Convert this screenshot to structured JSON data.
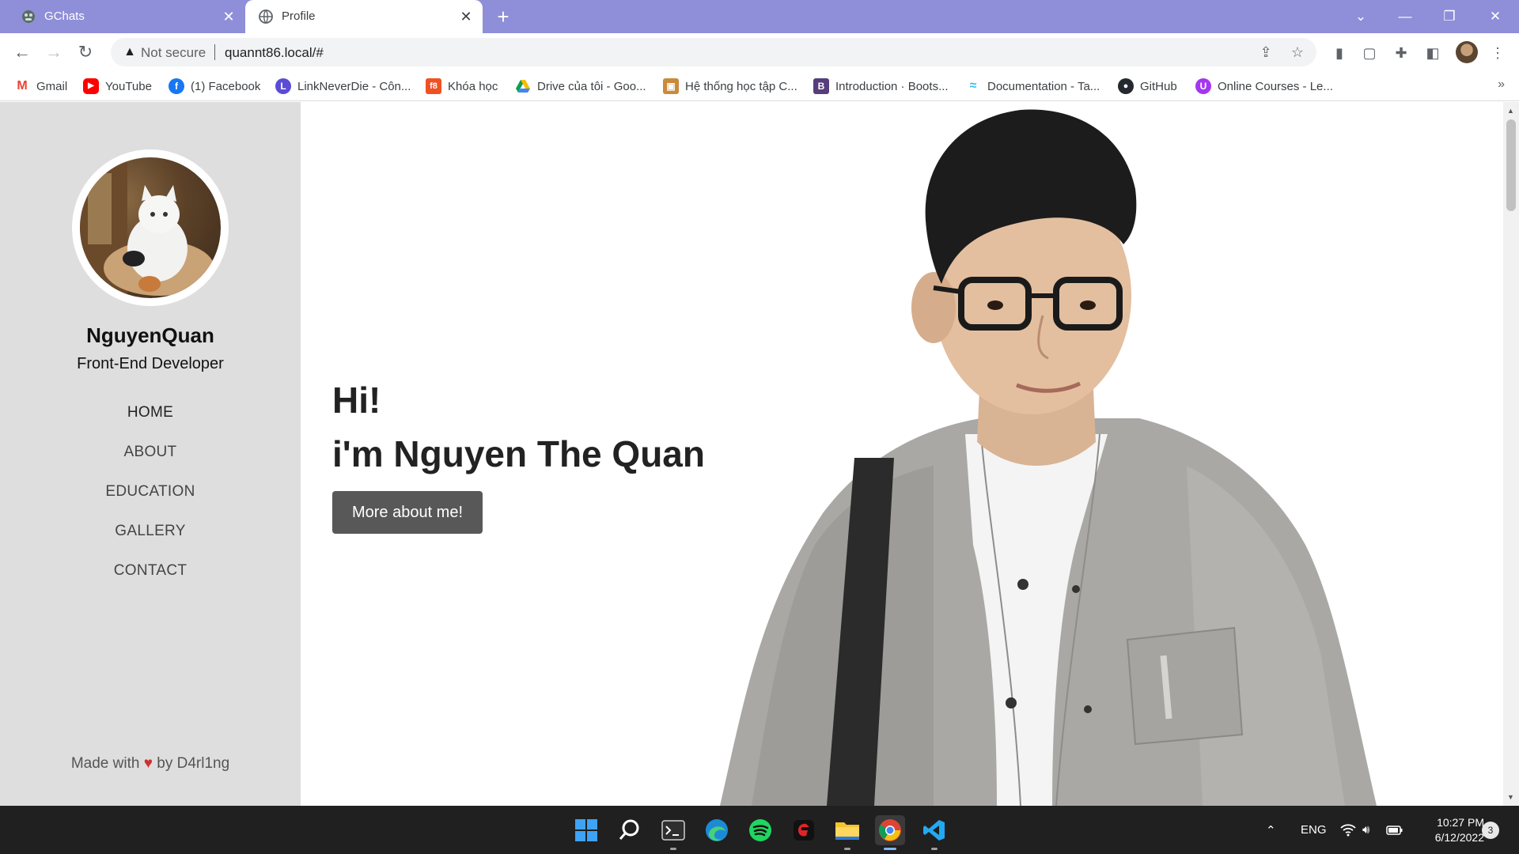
{
  "browser": {
    "tabs": [
      {
        "title": "GChats",
        "active": false
      },
      {
        "title": "Profile",
        "active": true
      }
    ],
    "address": {
      "security_label": "Not secure",
      "url": "quannt86.local/#"
    },
    "bookmarks": [
      {
        "label": "Gmail",
        "icon": "gmail-icon",
        "color": "#ea4335"
      },
      {
        "label": "YouTube",
        "icon": "youtube-icon",
        "color": "#ff0000"
      },
      {
        "label": "(1) Facebook",
        "icon": "facebook-icon",
        "color": "#1877f2"
      },
      {
        "label": "LinkNeverDie - Côn...",
        "icon": "linkneverdie-icon",
        "color": "#5b4bd6"
      },
      {
        "label": "Khóa học",
        "icon": "f8-icon",
        "color": "#f05123"
      },
      {
        "label": "Drive của tôi - Goo...",
        "icon": "google-drive-icon",
        "color": "#0f9d58"
      },
      {
        "label": "Hệ thống học tập C...",
        "icon": "box-icon",
        "color": "#c98a3a"
      },
      {
        "label": "Introduction · Boots...",
        "icon": "bootstrap-icon",
        "color": "#563d7c"
      },
      {
        "label": "Documentation - Ta...",
        "icon": "tailwind-icon",
        "color": "#38bdf8"
      },
      {
        "label": "GitHub",
        "icon": "github-icon",
        "color": "#24292f"
      },
      {
        "label": "Online Courses - Le...",
        "icon": "udemy-icon",
        "color": "#a435f0"
      }
    ]
  },
  "profile": {
    "name": "NguyenQuan",
    "role": "Front-End Developer",
    "menu": [
      "HOME",
      "ABOUT",
      "EDUCATION",
      "GALLERY",
      "CONTACT"
    ],
    "footer": {
      "prefix": "Made with",
      "suffix": "by D4rl1ng"
    }
  },
  "hero": {
    "greeting": "Hi!",
    "intro": "i'm Nguyen The Quan",
    "button_label": "More about me!"
  },
  "taskbar": {
    "language": "ENG",
    "time": "10:27 PM",
    "date": "6/12/2022",
    "notification_count": "3"
  },
  "colors": {
    "tabstrip": "#8f8ed9",
    "sidebar": "#dedede",
    "button": "#585858",
    "heart": "#d32f2f",
    "taskbar": "#202020"
  }
}
